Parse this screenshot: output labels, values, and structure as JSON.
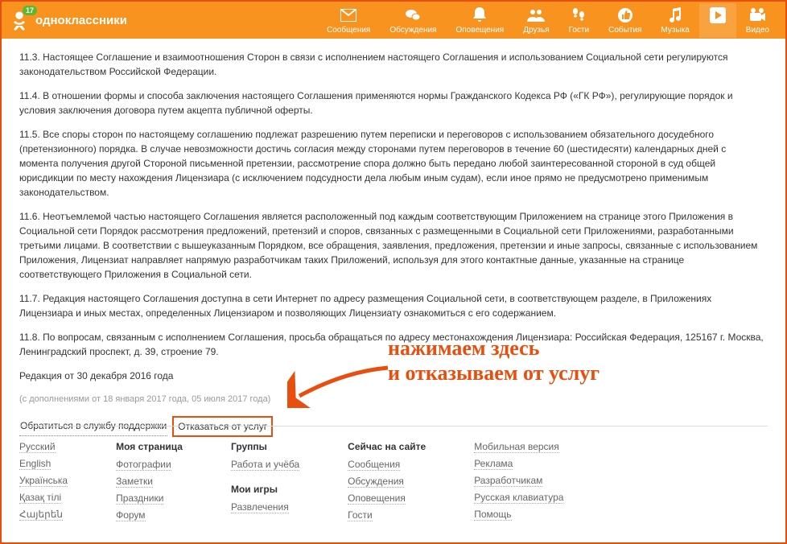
{
  "header": {
    "site_name": "одноклассники",
    "badge": "17",
    "nav": [
      {
        "label": "Сообщения"
      },
      {
        "label": "Обсуждения"
      },
      {
        "label": "Оповещения"
      },
      {
        "label": "Друзья"
      },
      {
        "label": "Гости"
      },
      {
        "label": "События"
      },
      {
        "label": "Музыка"
      },
      {
        "label": "Видео"
      }
    ]
  },
  "content": {
    "p113": "11.3. Настоящее Соглашение и взаимоотношения Сторон в связи с исполнением настоящего Соглашения и использованием Социальной сети регулируются законодательством Российской Федерации.",
    "p114": "11.4. В отношении формы и способа заключения настоящего Соглашения применяются нормы Гражданского Кодекса РФ («ГК РФ»), регулирующие порядок и условия заключения договора путем акцепта публичной оферты.",
    "p115": "11.5. Все споры сторон по настоящему соглашению подлежат разрешению путем переписки и переговоров с использованием обязательного досудебного (претензионного) порядка. В случае невозможности достичь согласия между сторонами путем переговоров в течение 60 (шестидесяти) календарных дней с момента получения другой Стороной письменной претензии, рассмотрение спора должно быть передано любой заинтересованной стороной в суд общей юрисдикции по месту нахождения Лицензиара (с исключением подсудности дела любым иным судам), если иное прямо не предусмотрено применимым законодательством.",
    "p116": "11.6. Неотъемлемой частью настоящего Соглашения является расположенный под каждым соответствующим Приложением на странице этого Приложения в Социальной сети Порядок рассмотрения предложений, претензий и споров, связанных с размещенными в Социальной сети Приложениями, разработанными третьими лицами. В соответствии с вышеуказанным Порядком, все обращения, заявления, предложения, претензии и иные запросы, связанные с использованием Приложения, Лицензиат направляет напрямую разработчикам таких Приложений, используя для этого контактные данные, указанные на странице соответствующего Приложения в Социальной сети.",
    "p117": "11.7. Редакция настоящего Соглашения доступна в сети Интернет по адресу размещения Социальной сети, в соответствующем разделе, в Приложениях Лицензиара и иных местах, определенных Лицензиаром и позволяющих Лицензиату ознакомиться с его содержанием.",
    "p118": "11.8. По вопросам, связанным с исполнением Соглашения, просьба обращаться по адресу местонахождения Лицензиара: Российская Федерация, 125167 г. Москва, Ленинградский проспект, д. 39, строение 79.",
    "revision": "Редакция от 30 декабря 2016 года",
    "supplement": "(с дополнениями от 18 января 2017 года, 05 июля 2017 года)"
  },
  "actions": {
    "support": "Обратиться в службу поддержки",
    "refuse": "Отказаться от услуг"
  },
  "annotation": {
    "line1": "нажимаем здесь",
    "line2": "и отказываем от услуг"
  },
  "footer": {
    "col1": [
      "Русский",
      "English",
      "Українська",
      "Қазақ тілі",
      "Հայերեն"
    ],
    "col2_head": "Моя страница",
    "col2": [
      "Фотографии",
      "Заметки",
      "Праздники",
      "Форум"
    ],
    "col3_head1": "Группы",
    "col3a": [
      "Работа и учёба"
    ],
    "col3_head2": "Мои игры",
    "col3b": [
      "Развлечения"
    ],
    "col4_head": "Сейчас на сайте",
    "col4": [
      "Сообщения",
      "Обсуждения",
      "Оповещения",
      "Гости"
    ],
    "col5": [
      "Мобильная версия",
      "Реклама",
      "Разработчикам",
      "Русская клавиатура",
      "Помощь"
    ]
  }
}
